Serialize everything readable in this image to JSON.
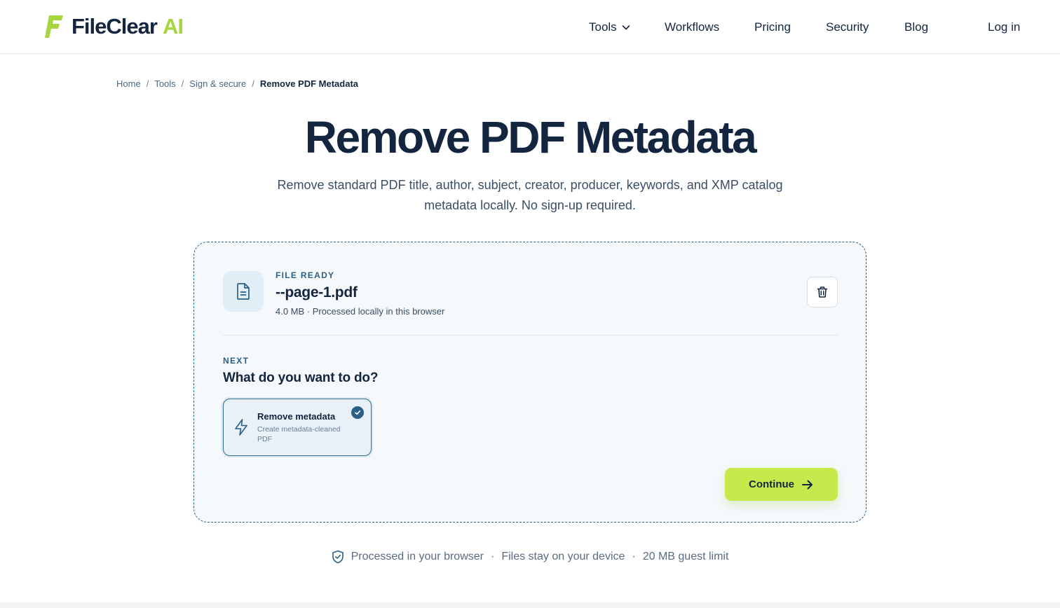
{
  "header": {
    "brand_name": "FileClear",
    "brand_suffix": "AI",
    "nav": {
      "tools": "Tools",
      "workflows": "Workflows",
      "pricing": "Pricing",
      "security": "Security",
      "blog": "Blog"
    },
    "login": "Log in"
  },
  "breadcrumb": {
    "home": "Home",
    "tools": "Tools",
    "category": "Sign & secure",
    "current": "Remove PDF Metadata",
    "separator": "/"
  },
  "page": {
    "title": "Remove PDF Metadata",
    "subtitle": "Remove standard PDF title, author, subject, creator, producer, keywords, and XMP catalog metadata locally. No sign-up required."
  },
  "file": {
    "eyebrow": "FILE READY",
    "name": "--page-1.pdf",
    "meta": "4.0 MB · Processed locally in this browser"
  },
  "next": {
    "eyebrow": "NEXT",
    "question": "What do you want to do?",
    "option": {
      "title": "Remove metadata",
      "description": "Create metadata-cleaned PDF",
      "selected": true
    },
    "continue_label": "Continue"
  },
  "trust": {
    "item1": "Processed in your browser",
    "item2": "Files stay on your device",
    "item3": "20 MB guest limit",
    "separator": "·"
  },
  "colors": {
    "brand_navy": "#13253f",
    "brand_lime": "#a6d63e",
    "accent_blue": "#2b5f86",
    "button_lime": "#c6ea4c"
  }
}
